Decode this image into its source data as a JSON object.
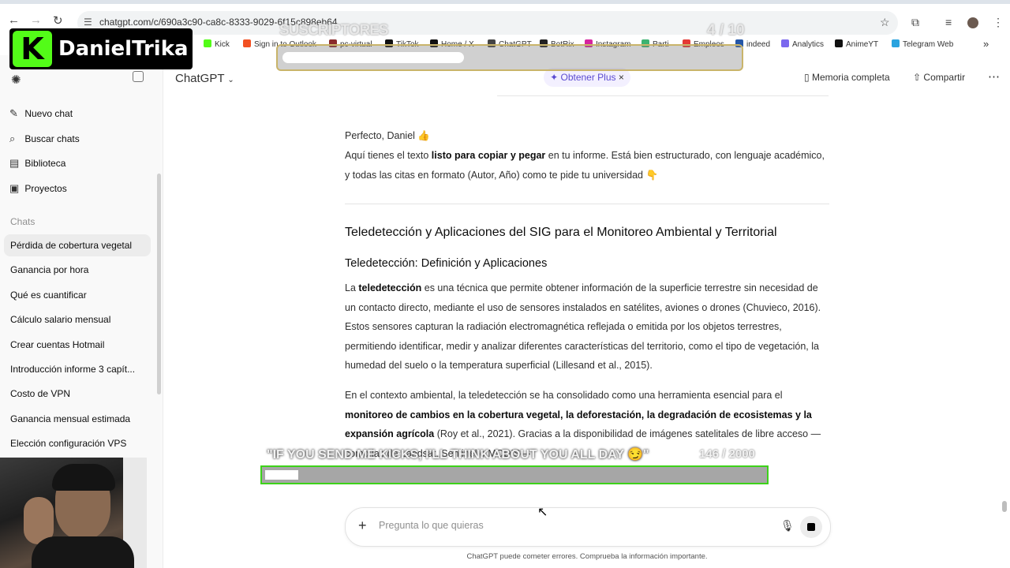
{
  "browser": {
    "url": "chatgpt.com/c/690a3c90-ca8c-8333-9029-6f15c898eb64",
    "bookmarks": [
      {
        "label": "Kick",
        "color": "#53fc18"
      },
      {
        "label": "Sign in to Outlook",
        "color": "#f25022"
      },
      {
        "label": "pc-virtual",
        "color": "#8a2b2b"
      },
      {
        "label": "TikTok",
        "color": "#111111"
      },
      {
        "label": "Home / X",
        "color": "#111111"
      },
      {
        "label": "ChatGPT",
        "color": "#444444"
      },
      {
        "label": "BotRix",
        "color": "#222222"
      },
      {
        "label": "Instagram",
        "color": "#d6249f"
      },
      {
        "label": "Parti",
        "color": "#3cb371"
      },
      {
        "label": "Empleos",
        "color": "#e53935"
      },
      {
        "label": "indeed",
        "color": "#2557a7"
      },
      {
        "label": "Analytics",
        "color": "#7b68ee"
      },
      {
        "label": "AnimeYT",
        "color": "#111111"
      },
      {
        "label": "Telegram Web",
        "color": "#2aa3df"
      }
    ]
  },
  "overlay": {
    "logo_letter": "K",
    "logo_name": "DanielTrika",
    "sub_label": "SUSCRIPTORES",
    "sub_count": "4 / 10",
    "sub_progress": 0.4,
    "kick_label": "\"IF YOU SEND ME KICKS, I'LL THINK ABOUT YOU ALL DAY 😏\"",
    "kick_count": "146 / 2000",
    "kick_progress": 0.073
  },
  "sidebar": {
    "nav": [
      {
        "icon": "✎",
        "label": "Nuevo chat"
      },
      {
        "icon": "⌕",
        "label": "Buscar chats"
      },
      {
        "icon": "▤",
        "label": "Biblioteca"
      },
      {
        "icon": "▣",
        "label": "Proyectos"
      }
    ],
    "section_label": "Chats",
    "chats": [
      "Pérdida de cobertura vegetal",
      "Ganancia por hora",
      "Qué es cuantificar",
      "Cálculo salario mensual",
      "Crear cuentas Hotmail",
      "Introducción informe 3 capít...",
      "Costo de VPN",
      "Ganancia mensual estimada",
      "Elección configuración VPS"
    ]
  },
  "topbar": {
    "model": "ChatGPT",
    "plus": "✦ Obtener Plus",
    "memory": "Memoria completa",
    "share": "Compartir"
  },
  "message": {
    "greeting": "Perfecto, Daniel 👍",
    "intro_pre": "Aquí tienes el texto ",
    "intro_bold": "listo para copiar y pegar",
    "intro_post": " en tu informe. Está bien estructurado, con lenguaje académico, y todas las citas en formato (Autor, Año) como te pide tu universidad 👇",
    "h1": "Teledetección y Aplicaciones del SIG para el Monitoreo Ambiental y Territorial",
    "h2": "Teledetección: Definición y Aplicaciones",
    "p1_pre": "La ",
    "p1_bold": "teledetección",
    "p1_post": " es una técnica que permite obtener información de la superficie terrestre sin necesidad de un contacto directo, mediante el uso de sensores instalados en satélites, aviones o drones (Chuvieco, 2016). Estos sensores capturan la radiación electromagnética reflejada o emitida por los objetos terrestres, permitiendo identificar, medir y analizar diferentes características del territorio, como el tipo de vegetación, la humedad del suelo o la temperatura superficial (Lillesand et al., 2015).",
    "p2_pre": "En el contexto ambiental, la teledetección se ha consolidado como una herramienta esencial para el ",
    "p2_bold": "monitoreo de cambios en la cobertura vegetal, la deforestación, la degradación de ecosistemas y la expansión agrícola",
    "p2_post": " (Roy et al., 2021). Gracias a la disponibilidad de imágenes satelitales de libre acceso —como las de Landsat, Sentinel o MODIS—"
  },
  "composer": {
    "placeholder": "Pregunta lo que quieras",
    "disclaimer": "ChatGPT puede cometer errores. Comprueba la información importante."
  }
}
